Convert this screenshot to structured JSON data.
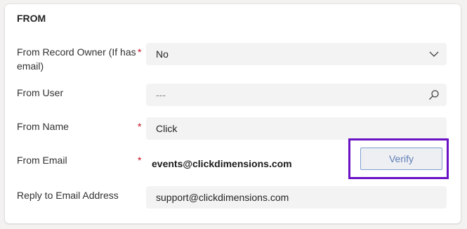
{
  "section": {
    "title": "FROM"
  },
  "fields": {
    "from_record_owner": {
      "label": "From Record Owner (If has email)",
      "required_mark": "*",
      "value": "No",
      "icon": "chevron-down-icon"
    },
    "from_user": {
      "label": "From User",
      "placeholder": "---",
      "icon": "search-icon"
    },
    "from_name": {
      "label": "From Name",
      "required_mark": "*",
      "value": "Click"
    },
    "from_email": {
      "label": "From Email",
      "required_mark": "*",
      "value": "events@clickdimensions.com",
      "verify_label": "Verify"
    },
    "reply_to": {
      "label": "Reply to Email Address",
      "value": "support@clickdimensions.com"
    }
  },
  "colors": {
    "required": "#c50f1f",
    "highlight_border": "#6a12c4",
    "verify_text": "#5f7fb5",
    "field_background": "#f3f3f3"
  }
}
